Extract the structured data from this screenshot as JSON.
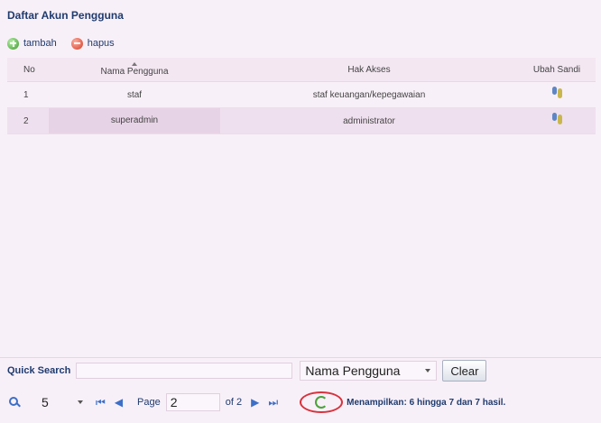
{
  "panel": {
    "title": "Daftar Akun Pengguna"
  },
  "toolbar": {
    "add_label": "tambah",
    "delete_label": "hapus"
  },
  "table": {
    "headers": {
      "no": "No",
      "nama": "Nama Pengguna",
      "hak": "Hak Akses",
      "sandi": "Ubah Sandi"
    },
    "rows": [
      {
        "no": "1",
        "nama": "staf",
        "hak": "staf keuangan/kepegawaian"
      },
      {
        "no": "2",
        "nama": "superadmin",
        "hak": "administrator"
      }
    ]
  },
  "search": {
    "label": "Quick Search",
    "value": "",
    "field": "Nama Pengguna",
    "clear_label": "Clear"
  },
  "pager": {
    "rows_per_page": "5",
    "page_label": "Page",
    "page_value": "2",
    "of_label": "of 2",
    "status": "Menampilkan: 6 hingga 7 dan 7 hasil."
  },
  "colors": {
    "title": "#1f3b6e",
    "highlight_circle": "#d8323c",
    "row_alt": "#efe0ef"
  }
}
